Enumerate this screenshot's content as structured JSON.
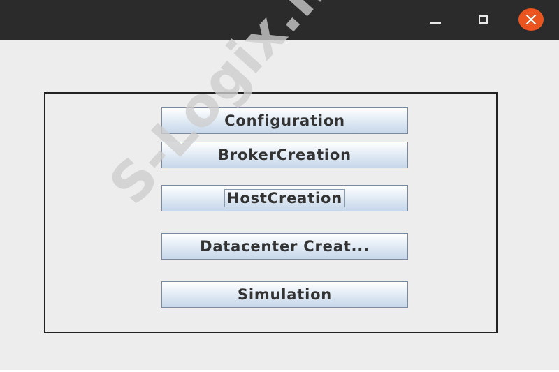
{
  "titlebar": {
    "minimize_icon": "minimize-icon",
    "maximize_icon": "maximize-icon",
    "close_icon": "close-icon",
    "close_color": "#e9541f",
    "background": "#2b2b2b"
  },
  "buttons": [
    {
      "label": "Configuration"
    },
    {
      "label": "BrokerCreation"
    },
    {
      "label": "HostCreation"
    },
    {
      "label": "Datacenter Creat..."
    },
    {
      "label": "Simulation"
    }
  ],
  "watermark": {
    "text": "S-Logix.in"
  }
}
